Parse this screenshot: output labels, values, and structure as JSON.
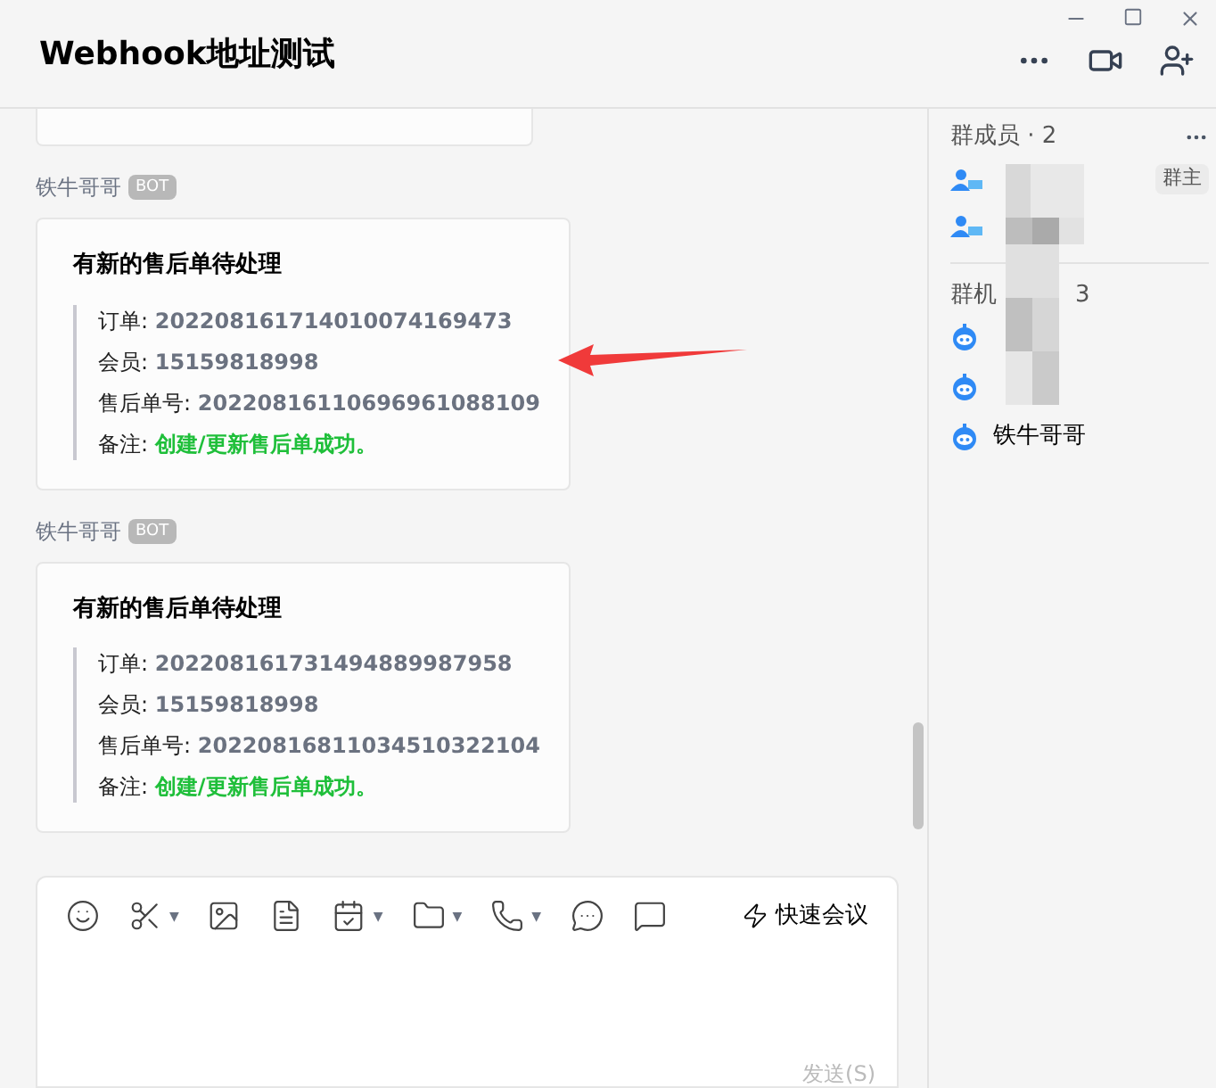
{
  "window": {
    "title": "Webhook地址测试"
  },
  "messages": [
    {
      "sender": "铁牛哥哥",
      "badge": "BOT",
      "title": "有新的售后单待处理",
      "fields": [
        {
          "label": "订单:",
          "value": "202208161714010074169473",
          "kind": "number"
        },
        {
          "label": "会员:",
          "value": "15159818998",
          "kind": "number"
        },
        {
          "label": "售后单号:",
          "value": "20220816110696961088109",
          "kind": "number"
        },
        {
          "label": "备注:",
          "value": "创建/更新售后单成功。",
          "kind": "note"
        }
      ]
    },
    {
      "sender": "铁牛哥哥",
      "badge": "BOT",
      "title": "有新的售后单待处理",
      "fields": [
        {
          "label": "订单:",
          "value": "202208161731494889987958",
          "kind": "number"
        },
        {
          "label": "会员:",
          "value": "15159818998",
          "kind": "number"
        },
        {
          "label": "售后单号:",
          "value": "20220816811034510322104",
          "kind": "number"
        },
        {
          "label": "备注:",
          "value": "创建/更新售后单成功。",
          "kind": "note"
        }
      ]
    }
  ],
  "composer": {
    "tools": [
      {
        "kind": "emoji"
      },
      {
        "kind": "scissors",
        "caret": "▼"
      },
      {
        "kind": "image"
      },
      {
        "kind": "document"
      },
      {
        "kind": "calendar",
        "caret": "▼"
      },
      {
        "kind": "folder",
        "caret": "▼"
      },
      {
        "kind": "phone",
        "caret": "▼"
      },
      {
        "kind": "more"
      },
      {
        "kind": "schedule"
      }
    ],
    "quick_meeting": "快速会议",
    "send": "发送(S)"
  },
  "side": {
    "members_title": "群成员 · 2",
    "owner_badge": "群主",
    "members": [
      {
        "owner": true
      },
      {
        "owner": false
      }
    ],
    "robots_title": "群机",
    "robots_count": "3",
    "robots": [
      {
        "kind": "robot"
      },
      {
        "kind": "robot"
      },
      {
        "kind": "robot",
        "name": "铁牛哥哥"
      }
    ]
  }
}
